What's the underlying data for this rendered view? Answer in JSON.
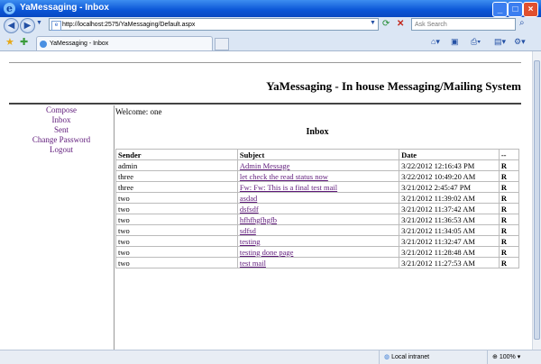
{
  "window": {
    "title": "YaMessaging - Inbox"
  },
  "browser": {
    "url": "http://localhost:2575/YaMessaging/Default.aspx",
    "search_placeholder": "Ask Search",
    "tab_title": "YaMessaging - Inbox",
    "status_zone": "Local intranet",
    "zoom": "100%"
  },
  "page": {
    "header_title": "YaMessaging - In house Messaging/Mailing System",
    "nav": [
      "Compose",
      "Inbox",
      "Sent",
      "Change Password",
      "Logout"
    ],
    "welcome": "Welcome: one",
    "heading": "Inbox",
    "columns": [
      "Sender",
      "Subject",
      "Date",
      "--"
    ],
    "rows": [
      {
        "sender": "admin",
        "subject": "Admin Message",
        "date": "3/22/2012 12:16:43 PM",
        "flag": "R"
      },
      {
        "sender": "three",
        "subject": "let check the read status now",
        "date": "3/22/2012 10:49:20 AM",
        "flag": "R"
      },
      {
        "sender": "three",
        "subject": "Fw: Fw: This is a final test mail",
        "date": "3/21/2012 2:45:47 PM",
        "flag": "R"
      },
      {
        "sender": "two",
        "subject": "asdad",
        "date": "3/21/2012 11:39:02 AM",
        "flag": "R"
      },
      {
        "sender": "two",
        "subject": "dsfsdf",
        "date": "3/21/2012 11:37:42 AM",
        "flag": "R"
      },
      {
        "sender": "two",
        "subject": "hfhfhgfhgfb",
        "date": "3/21/2012 11:36:53 AM",
        "flag": "R"
      },
      {
        "sender": "two",
        "subject": "sdfsd",
        "date": "3/21/2012 11:34:05 AM",
        "flag": "R"
      },
      {
        "sender": "two",
        "subject": "testing",
        "date": "3/21/2012 11:32:47 AM",
        "flag": "R"
      },
      {
        "sender": "two",
        "subject": "testing done page",
        "date": "3/21/2012 11:28:48 AM",
        "flag": "R"
      },
      {
        "sender": "two",
        "subject": "test mail",
        "date": "3/21/2012 11:27:53 AM",
        "flag": "R"
      }
    ]
  }
}
